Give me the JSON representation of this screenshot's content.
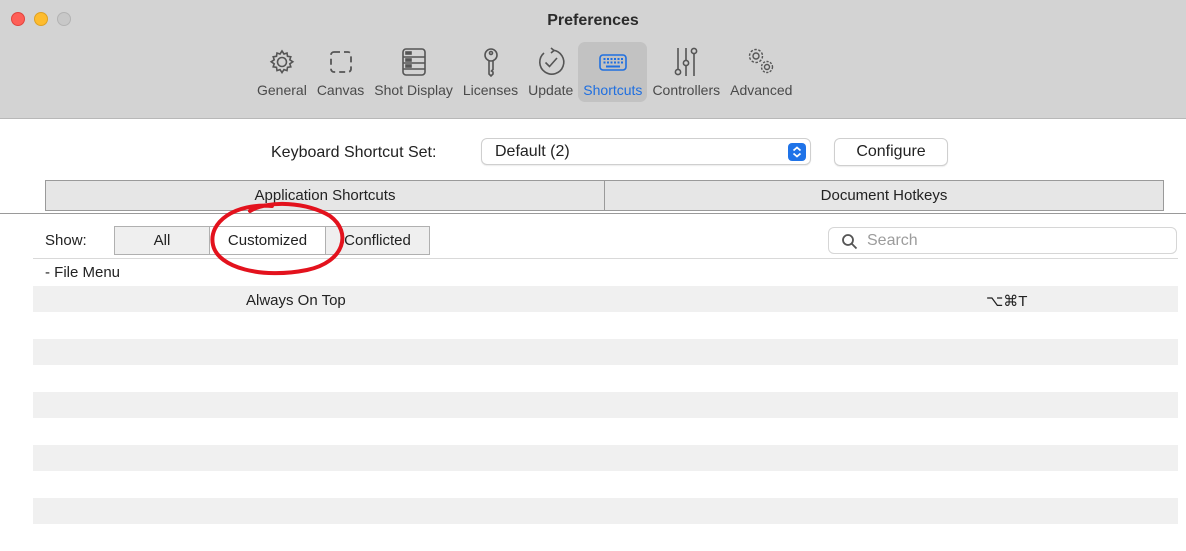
{
  "window": {
    "title": "Preferences"
  },
  "toolbar": {
    "items": [
      {
        "label": "General",
        "icon": "gear-icon",
        "active": false
      },
      {
        "label": "Canvas",
        "icon": "canvas-icon",
        "active": false
      },
      {
        "label": "Shot Display",
        "icon": "shot-display-icon",
        "active": false
      },
      {
        "label": "Licenses",
        "icon": "key-icon",
        "active": false
      },
      {
        "label": "Update",
        "icon": "update-check-icon",
        "active": false
      },
      {
        "label": "Shortcuts",
        "icon": "keyboard-icon",
        "active": true
      },
      {
        "label": "Controllers",
        "icon": "sliders-icon",
        "active": false
      },
      {
        "label": "Advanced",
        "icon": "gears-icon",
        "active": false
      }
    ]
  },
  "shortcut_set": {
    "label": "Keyboard Shortcut Set:",
    "value": "Default (2)",
    "configure_label": "Configure"
  },
  "tabs": [
    {
      "label": "Application Shortcuts",
      "selected": true
    },
    {
      "label": "Document Hotkeys",
      "selected": false
    }
  ],
  "filter": {
    "label": "Show:",
    "options": [
      "All",
      "Customized",
      "Conflicted"
    ],
    "selected": "Customized"
  },
  "search": {
    "placeholder": "Search"
  },
  "list": {
    "group": "- File Menu",
    "items": [
      {
        "command": "Always On Top",
        "shortcut": "⌥⌘T"
      }
    ]
  },
  "colors": {
    "accent": "#1f6fe0",
    "annotation": "#e3121d",
    "close": "#fe5f57",
    "minimize": "#febc2e",
    "zoom": "#c8c8c8"
  }
}
